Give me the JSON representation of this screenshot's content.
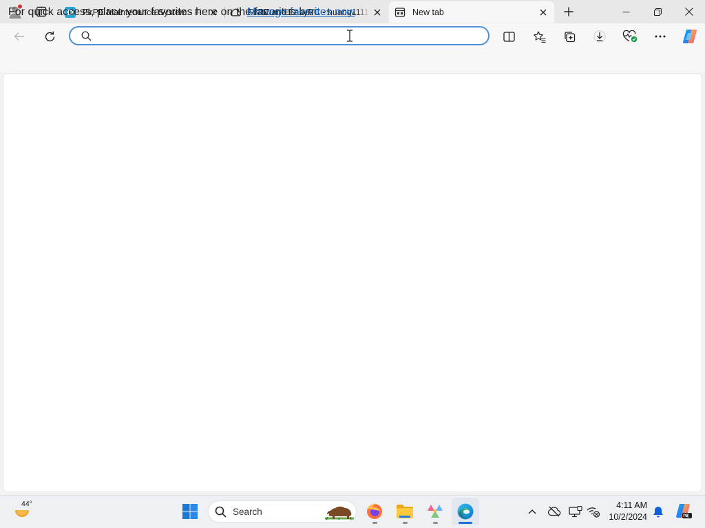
{
  "tabs": [
    {
      "title": "FirPE Maintenance System - FirPE",
      "favicon": "firpe-favicon",
      "active": false
    },
    {
      "title": "FirPE and EasyRC - huang1111 ne",
      "favicon": "cloud-favicon",
      "active": false
    },
    {
      "title": "New tab",
      "favicon": "newtab-favicon",
      "active": true
    }
  ],
  "address_bar": {
    "value": "",
    "placeholder": ""
  },
  "favorites_bar": {
    "message": "For quick access, place your favorites here on the favorites bar.",
    "link": "Manage favorites now"
  },
  "taskbar": {
    "weather": {
      "temp": "44°",
      "icon": "weather-sun-icon"
    },
    "search_label": "Search",
    "pinned_apps": [
      "windows-start",
      "search",
      "firefox",
      "file-explorer",
      "app-launcher",
      "edge"
    ],
    "clock": {
      "time": "4:11 AM",
      "date": "10/2/2024"
    }
  },
  "colors": {
    "accent": "#4b8fd8",
    "link": "#0f5fb4",
    "profile_dot": "#d13438",
    "notification_bell": "#0f5fd8"
  }
}
